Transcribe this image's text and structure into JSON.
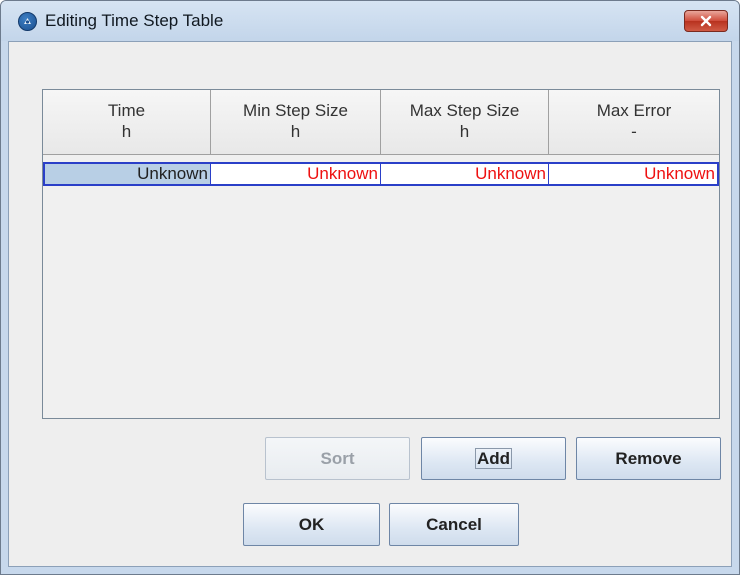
{
  "window": {
    "title": "Editing Time Step Table",
    "close_icon": "close-icon"
  },
  "table": {
    "columns": [
      {
        "name": "Time",
        "unit": "h"
      },
      {
        "name": "Min Step Size",
        "unit": "h"
      },
      {
        "name": "Max Step Size",
        "unit": "h"
      },
      {
        "name": "Max Error",
        "unit": "-"
      }
    ],
    "rows": [
      [
        "Unknown",
        "Unknown",
        "Unknown",
        "Unknown"
      ]
    ],
    "selected_cell_color": "#b8cfe5",
    "unknown_value_color": "#ee1111"
  },
  "buttons": {
    "sort": "Sort",
    "add": "Add",
    "remove": "Remove",
    "ok": "OK",
    "cancel": "Cancel"
  }
}
